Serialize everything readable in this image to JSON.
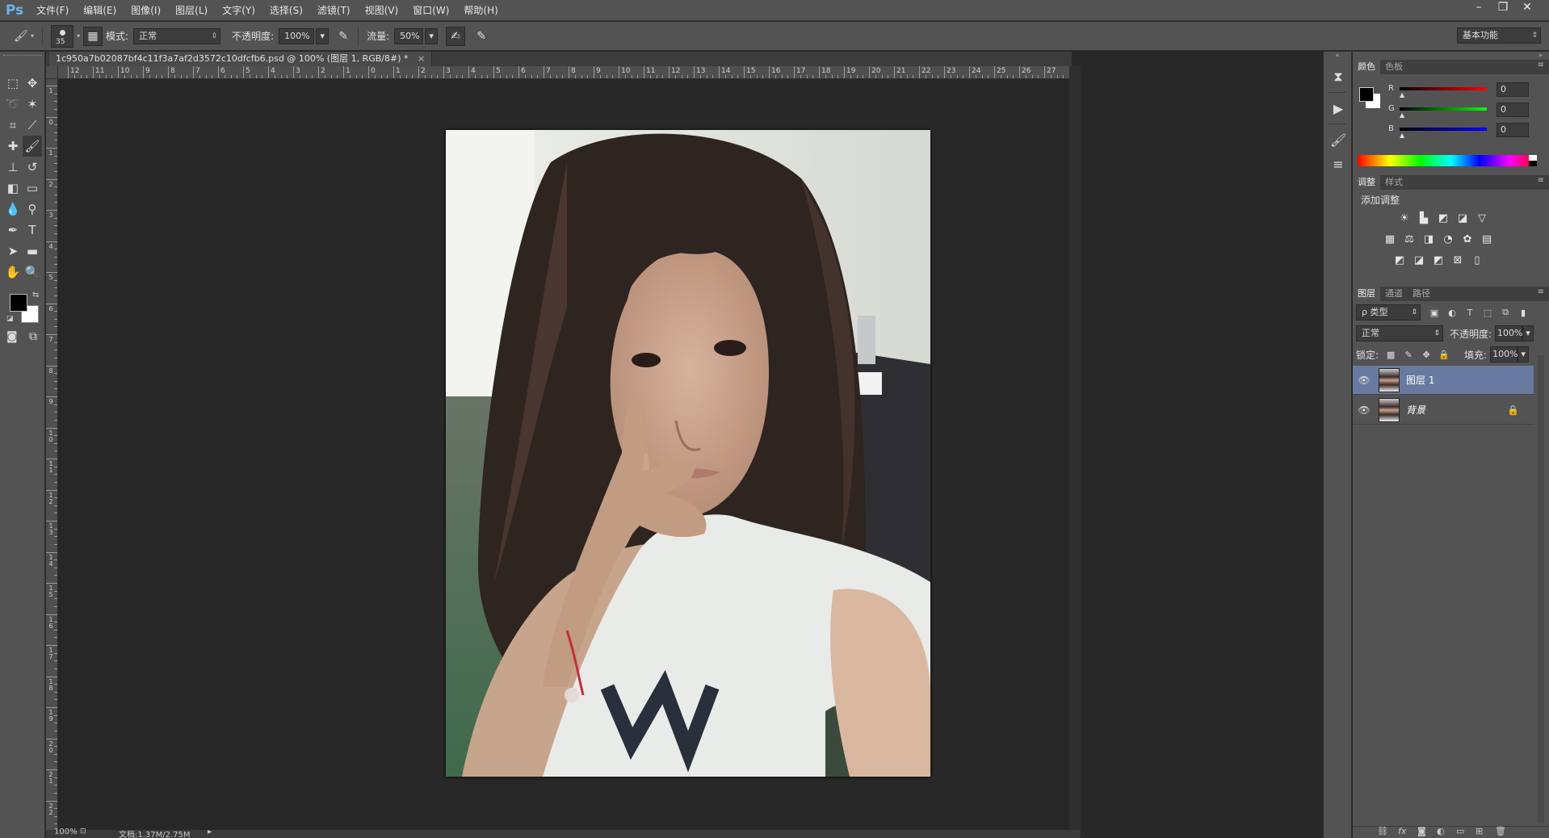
{
  "app": {
    "logo": "Ps",
    "menu": [
      "文件(F)",
      "编辑(E)",
      "图像(I)",
      "图层(L)",
      "文字(Y)",
      "选择(S)",
      "滤镜(T)",
      "视图(V)",
      "窗口(W)",
      "帮助(H)"
    ],
    "window_controls": {
      "minimize": "–",
      "restore": "❐",
      "close": "✕"
    }
  },
  "options": {
    "brush_size": "35",
    "mode_label": "模式:",
    "mode_value": "正常",
    "opacity_label": "不透明度:",
    "opacity_value": "100%",
    "flow_label": "流量:",
    "flow_value": "50%",
    "workspace": "基本功能"
  },
  "document": {
    "tab_title": "1c950a7b02087bf4c11f3a7af2d3572c10dfcfb6.psd @ 100% (图层 1, RGB/8#) *",
    "close": "×",
    "ruler_top": [
      "12",
      "11",
      "10",
      "9",
      "8",
      "7",
      "6",
      "5",
      "4",
      "3",
      "2",
      "1",
      "0",
      "1",
      "2",
      "3",
      "4",
      "5",
      "6",
      "7",
      "8",
      "9",
      "10",
      "11",
      "12",
      "13",
      "14",
      "15",
      "16",
      "17",
      "18",
      "19",
      "20",
      "21",
      "22",
      "23",
      "24",
      "25",
      "26",
      "27"
    ],
    "ruler_left": [
      "1",
      "0",
      "1",
      "2",
      "3",
      "4",
      "5",
      "6",
      "7",
      "8",
      "9",
      "10",
      "11",
      "12",
      "13",
      "14",
      "15",
      "16",
      "17",
      "18",
      "19",
      "20",
      "21",
      "22"
    ]
  },
  "status": {
    "zoom": "100%",
    "doc_size": "文档:1.37M/2.75M",
    "arrow": "▸"
  },
  "color_panel": {
    "tabs": [
      "颜色",
      "色板"
    ],
    "channels": [
      {
        "label": "R",
        "value": "0",
        "gradient": "linear-gradient(90deg,#000,#f00)"
      },
      {
        "label": "G",
        "value": "0",
        "gradient": "linear-gradient(90deg,#000,#0f0)"
      },
      {
        "label": "B",
        "value": "0",
        "gradient": "linear-gradient(90deg,#000,#00f)"
      }
    ]
  },
  "adjust_panel": {
    "tabs": [
      "调整",
      "样式"
    ],
    "title": "添加调整"
  },
  "layers_panel": {
    "tabs": [
      "图层",
      "通道",
      "路径"
    ],
    "filter_kind": "ρ 类型",
    "blend_mode": "正常",
    "opacity_label": "不透明度:",
    "opacity_value": "100%",
    "lock_label": "锁定:",
    "fill_label": "填充:",
    "fill_value": "100%",
    "layers": [
      {
        "name": "图层 1",
        "selected": true,
        "locked": false
      },
      {
        "name": "背景",
        "selected": false,
        "locked": true
      }
    ]
  }
}
